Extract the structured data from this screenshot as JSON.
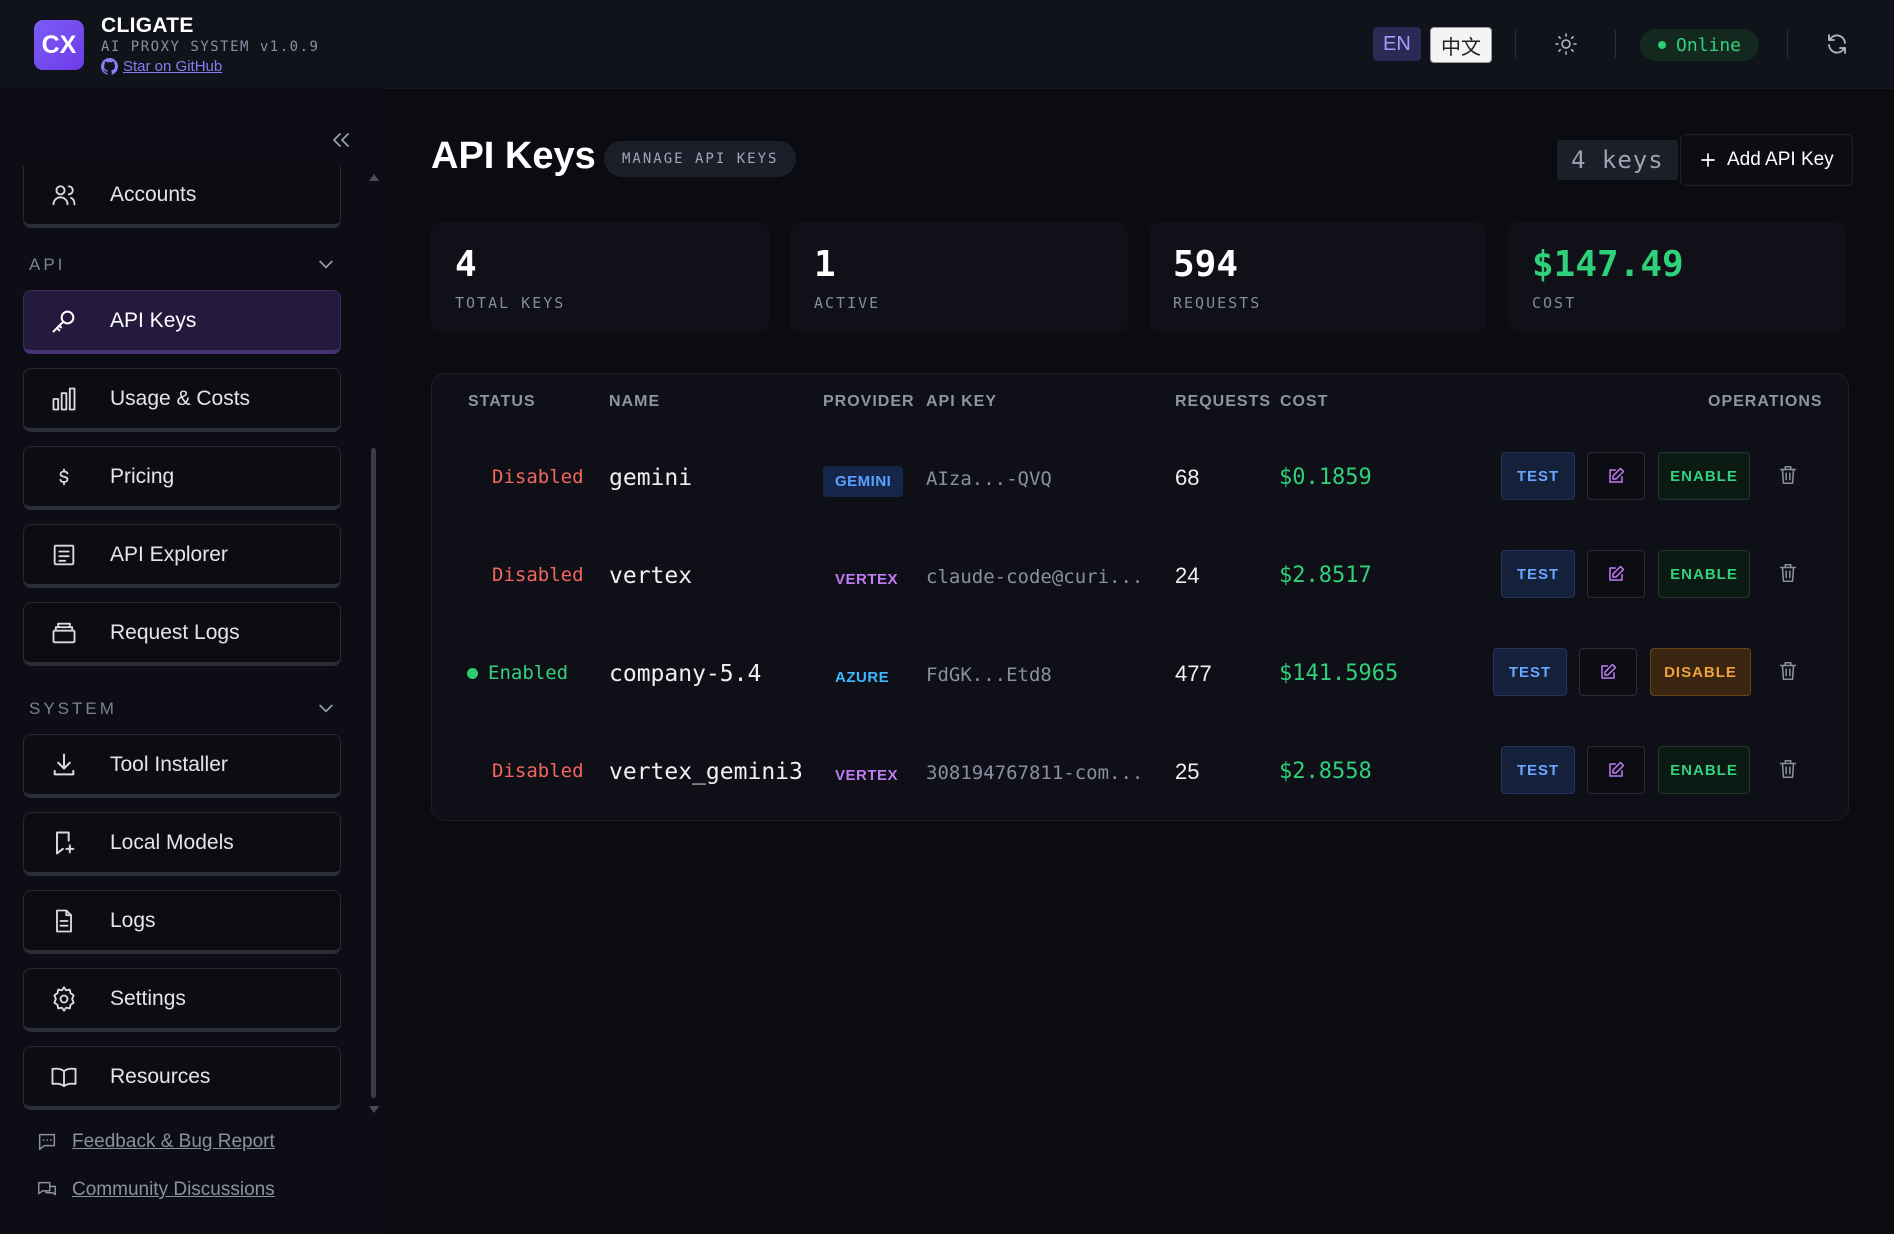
{
  "header": {
    "logo": "CX",
    "title": "CLIGATE",
    "subtitle": "AI PROXY SYSTEM v1.0.9",
    "github_link": "Star on GitHub",
    "lang_en": "EN",
    "lang_zh": "中文",
    "status": "Online"
  },
  "sidebar": {
    "items_top": [
      {
        "label": "Accounts",
        "icon": "users-icon"
      }
    ],
    "section_api": "API",
    "api_items": [
      {
        "label": "API Keys",
        "icon": "key-icon",
        "active": true
      },
      {
        "label": "Usage & Costs",
        "icon": "bar-chart-icon"
      },
      {
        "label": "Pricing",
        "icon": "dollar-icon"
      },
      {
        "label": "API Explorer",
        "icon": "document-icon"
      },
      {
        "label": "Request Logs",
        "icon": "archive-icon"
      }
    ],
    "section_system": "SYSTEM",
    "system_items": [
      {
        "label": "Tool Installer",
        "icon": "download-icon"
      },
      {
        "label": "Local Models",
        "icon": "bookmark-plus-icon"
      },
      {
        "label": "Logs",
        "icon": "file-text-icon"
      },
      {
        "label": "Settings",
        "icon": "gear-icon"
      },
      {
        "label": "Resources",
        "icon": "book-open-icon"
      }
    ],
    "footer_links": [
      {
        "label": "Feedback & Bug Report",
        "icon": "message-icon"
      },
      {
        "label": "Community Discussions",
        "icon": "chat-icon"
      }
    ]
  },
  "main": {
    "title": "API Keys",
    "chip": "MANAGE API KEYS",
    "keys_count": "4 keys",
    "add_button": "Add API Key",
    "stats": [
      {
        "value": "4",
        "label": "TOTAL KEYS"
      },
      {
        "value": "1",
        "label": "ACTIVE"
      },
      {
        "value": "594",
        "label": "REQUESTS"
      },
      {
        "value": "$147.49",
        "label": "COST"
      }
    ],
    "table": {
      "headers": [
        "STATUS",
        "NAME",
        "PROVIDER",
        "API KEY",
        "REQUESTS",
        "COST",
        "OPERATIONS"
      ],
      "rows": [
        {
          "status": "Disabled",
          "name": "gemini",
          "provider": "GEMINI",
          "api_key": "AIza...-QVQ",
          "requests": "68",
          "cost": "$0.1859",
          "action": "ENABLE"
        },
        {
          "status": "Disabled",
          "name": "vertex",
          "provider": "VERTEX",
          "api_key": "claude-code@curi...",
          "requests": "24",
          "cost": "$2.8517",
          "action": "ENABLE"
        },
        {
          "status": "Enabled",
          "name": "company-5.4",
          "provider": "AZURE",
          "api_key": "FdGK...Etd8",
          "requests": "477",
          "cost": "$141.5965",
          "action": "DISABLE"
        },
        {
          "status": "Disabled",
          "name": "vertex_gemini3",
          "provider": "VERTEX",
          "api_key": "308194767811-com...",
          "requests": "25",
          "cost": "$2.8558",
          "action": "ENABLE"
        }
      ],
      "test_label": "TEST"
    }
  },
  "colors": {
    "accent": "#7c5cf5",
    "success": "#35d07f",
    "danger": "#f2665c",
    "warning": "#f0a23a"
  }
}
